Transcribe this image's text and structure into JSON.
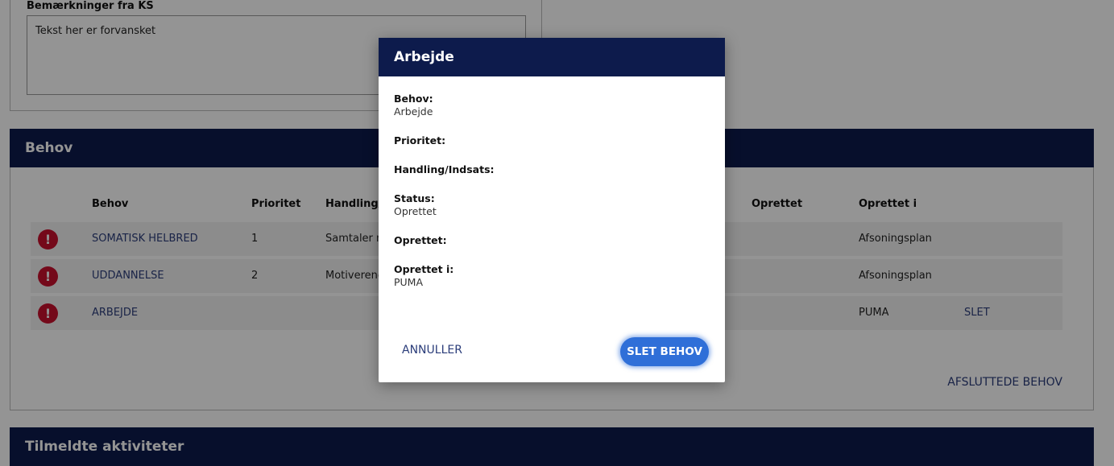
{
  "remarks": {
    "label": "Bemærkninger fra KS",
    "text": "Tekst her er forvansket"
  },
  "behov_panel": {
    "title": "Behov",
    "columns": [
      "Behov",
      "Prioritet",
      "Handling/Indsats",
      "Oprettet",
      "Oprettet i"
    ],
    "rows": [
      {
        "alert": "!",
        "behov": "SOMATISK HELBRED",
        "prioritet": "1",
        "handling": "Samtaler med",
        "oprettet_i": "Afsoningsplan",
        "action": ""
      },
      {
        "alert": "!",
        "behov": "UDDANNELSE",
        "prioritet": "2",
        "handling": "Motiverende",
        "oprettet_i": "Afsoningsplan",
        "action": ""
      },
      {
        "alert": "!",
        "behov": "ARBEJDE",
        "prioritet": "",
        "handling": "",
        "oprettet_i": "PUMA",
        "action": "SLET"
      }
    ],
    "afsluttede_link": "AFSLUTTEDE BEHOV"
  },
  "aktiviteter_panel": {
    "title": "Tilmeldte aktiviteter"
  },
  "modal": {
    "title": "Arbejde",
    "fields": [
      {
        "label": "Behov:",
        "value": "Arbejde"
      },
      {
        "label": "Prioritet:",
        "value": ""
      },
      {
        "label": "Handling/Indsats:",
        "value": ""
      },
      {
        "label": "Status:",
        "value": "Oprettet"
      },
      {
        "label": "Oprettet:",
        "value": ""
      },
      {
        "label": "Oprettet i:",
        "value": "PUMA"
      }
    ],
    "cancel_label": "ANNULLER",
    "confirm_label": "SLET BEHOV"
  },
  "colors": {
    "header_bg": "#0d1b4c",
    "primary_button": "#2f6fd8",
    "alert_red": "#c8102e",
    "link": "#2b3d7a"
  }
}
